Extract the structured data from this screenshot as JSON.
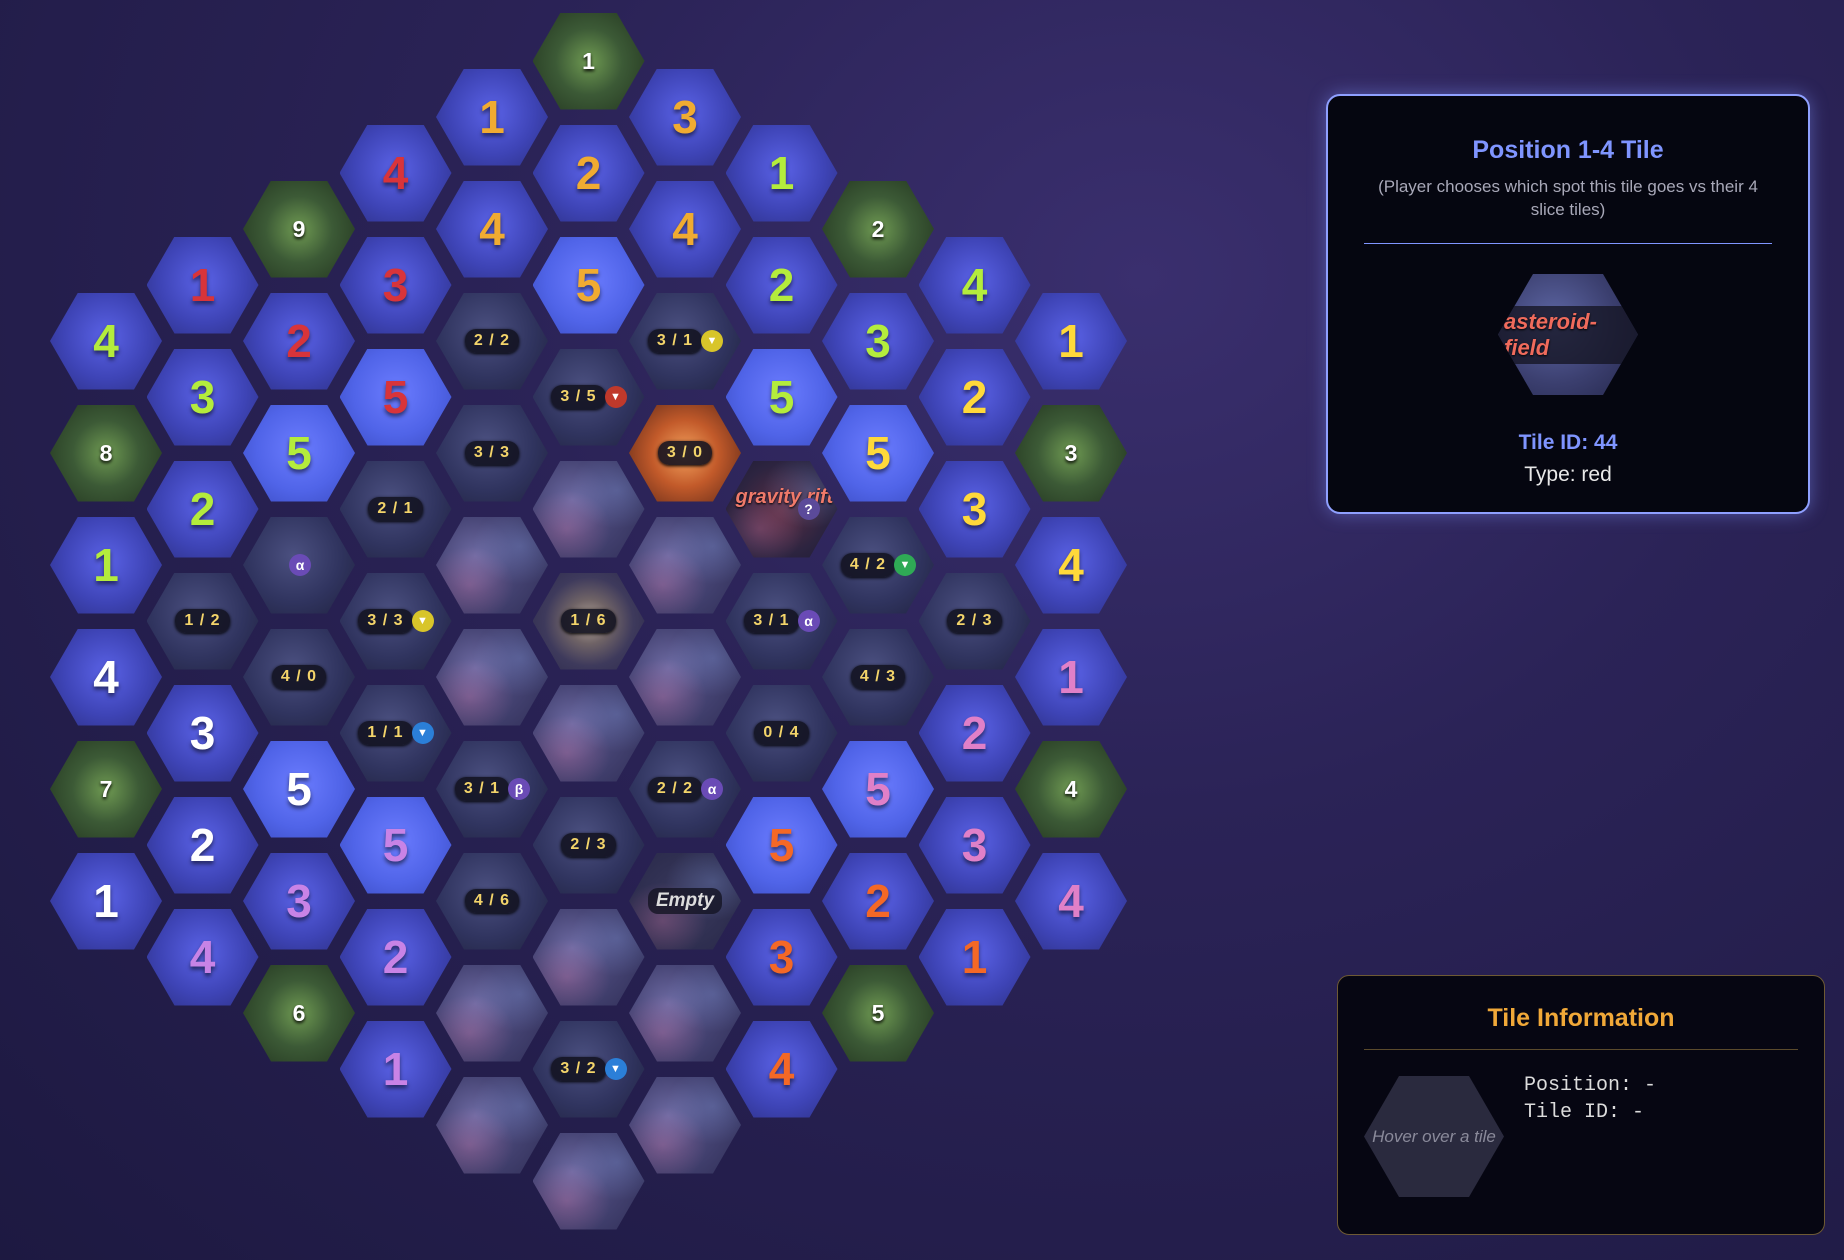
{
  "selected": {
    "title": "Position 1-4 Tile",
    "subtitle": "(Player chooses which spot this tile goes vs their 4 slice tiles)",
    "preview_label": "asteroid-field",
    "tile_id_text": "Tile ID: 44",
    "type_text": "Type: red"
  },
  "info": {
    "title": "Tile Information",
    "hover_text": "Hover over a tile",
    "position_text": "Position: -",
    "tile_id_text": "Tile ID: -"
  },
  "colors": {
    "lime": "#b4ec3c",
    "orange": "#f0ab31",
    "red": "#d8343a",
    "white": "#ffffff",
    "yellow": "#ffd93a",
    "pink": "#e080c8",
    "deep_orange": "#f46826",
    "violet": "#c883e6"
  },
  "tiles": [
    {
      "row": 0,
      "col": 5,
      "kind": "home",
      "label": "1"
    },
    {
      "row": 1,
      "col": 4,
      "kind": "num",
      "label": "1",
      "color": "#f0ab31"
    },
    {
      "row": 1,
      "col": 6,
      "kind": "num",
      "label": "3",
      "color": "#f0ab31"
    },
    {
      "row": 2,
      "col": 3,
      "kind": "num",
      "label": "4",
      "color": "#d8343a"
    },
    {
      "row": 2,
      "col": 5,
      "kind": "num",
      "label": "2",
      "color": "#f0ab31"
    },
    {
      "row": 2,
      "col": 7,
      "kind": "num",
      "label": "1",
      "color": "#b4ec3c"
    },
    {
      "row": 3,
      "col": 2,
      "kind": "home",
      "label": "9"
    },
    {
      "row": 3,
      "col": 4,
      "kind": "num",
      "label": "4",
      "color": "#f0ab31"
    },
    {
      "row": 3,
      "col": 6,
      "kind": "num",
      "label": "4",
      "color": "#f0ab31"
    },
    {
      "row": 3,
      "col": 8,
      "kind": "home",
      "label": "2"
    },
    {
      "row": 4,
      "col": 1,
      "kind": "num",
      "label": "1",
      "color": "#d8343a"
    },
    {
      "row": 4,
      "col": 3,
      "kind": "num",
      "label": "3",
      "color": "#d8343a"
    },
    {
      "row": 4,
      "col": 5,
      "kind": "num",
      "label": "5",
      "color": "#f0ab31",
      "bright": true
    },
    {
      "row": 4,
      "col": 7,
      "kind": "num",
      "label": "2",
      "color": "#b4ec3c"
    },
    {
      "row": 4,
      "col": 9,
      "kind": "num",
      "label": "4",
      "color": "#b4ec3c"
    },
    {
      "row": 5,
      "col": 0,
      "kind": "num",
      "label": "4",
      "color": "#b4ec3c"
    },
    {
      "row": 5,
      "col": 2,
      "kind": "num",
      "label": "2",
      "color": "#d8343a"
    },
    {
      "row": 5,
      "col": 4,
      "kind": "planet",
      "label": "2 / 2"
    },
    {
      "row": 5,
      "col": 6,
      "kind": "planet",
      "label": "3 / 1",
      "badge": "yellow"
    },
    {
      "row": 5,
      "col": 8,
      "kind": "num",
      "label": "3",
      "color": "#b4ec3c"
    },
    {
      "row": 5,
      "col": 10,
      "kind": "num",
      "label": "1",
      "color": "#ffd93a"
    },
    {
      "row": 6,
      "col": 1,
      "kind": "num",
      "label": "3",
      "color": "#b4ec3c"
    },
    {
      "row": 6,
      "col": 3,
      "kind": "num",
      "label": "5",
      "color": "#d8343a",
      "bright": true
    },
    {
      "row": 6,
      "col": 5,
      "kind": "planet",
      "label": "3 / 5",
      "badge": "red"
    },
    {
      "row": 6,
      "col": 7,
      "kind": "num",
      "label": "5",
      "color": "#b4ec3c",
      "bright": true
    },
    {
      "row": 6,
      "col": 9,
      "kind": "num",
      "label": "2",
      "color": "#ffd93a"
    },
    {
      "row": 7,
      "col": 0,
      "kind": "home",
      "label": "8"
    },
    {
      "row": 7,
      "col": 2,
      "kind": "num",
      "label": "5",
      "color": "#b4ec3c",
      "bright": true
    },
    {
      "row": 7,
      "col": 4,
      "kind": "planet",
      "label": "3 / 3"
    },
    {
      "row": 7,
      "col": 6,
      "kind": "supernova",
      "label": "3 / 0"
    },
    {
      "row": 7,
      "col": 8,
      "kind": "num",
      "label": "5",
      "color": "#ffd93a",
      "bright": true
    },
    {
      "row": 7,
      "col": 10,
      "kind": "home",
      "label": "3"
    },
    {
      "row": 8,
      "col": 1,
      "kind": "num",
      "label": "2",
      "color": "#b4ec3c"
    },
    {
      "row": 8,
      "col": 3,
      "kind": "planet",
      "label": "2 / 1"
    },
    {
      "row": 8,
      "col": 5,
      "kind": "nebula"
    },
    {
      "row": 8,
      "col": 7,
      "kind": "rift",
      "label": "gravity rift",
      "badge": "?"
    },
    {
      "row": 8,
      "col": 9,
      "kind": "num",
      "label": "3",
      "color": "#ffd93a"
    },
    {
      "row": 9,
      "col": 0,
      "kind": "num",
      "label": "1",
      "color": "#b4ec3c"
    },
    {
      "row": 9,
      "col": 2,
      "kind": "planet",
      "badge": "α"
    },
    {
      "row": 9,
      "col": 4,
      "kind": "nebula"
    },
    {
      "row": 9,
      "col": 6,
      "kind": "nebula"
    },
    {
      "row": 9,
      "col": 8,
      "kind": "planet",
      "label": "4 / 2",
      "badge": "green"
    },
    {
      "row": 9,
      "col": 10,
      "kind": "num",
      "label": "4",
      "color": "#ffd93a"
    },
    {
      "row": 10,
      "col": 1,
      "kind": "planet",
      "label": "1 / 2"
    },
    {
      "row": 10,
      "col": 3,
      "kind": "planet",
      "label": "3 / 3",
      "badge": "yellow"
    },
    {
      "row": 10,
      "col": 5,
      "kind": "center",
      "label": "1 / 6"
    },
    {
      "row": 10,
      "col": 7,
      "kind": "planet",
      "label": "3 / 1",
      "badge": "α"
    },
    {
      "row": 10,
      "col": 9,
      "kind": "planet",
      "label": "2 / 3"
    },
    {
      "row": 11,
      "col": 0,
      "kind": "num",
      "label": "4",
      "color": "#ffffff"
    },
    {
      "row": 11,
      "col": 2,
      "kind": "planet",
      "label": "4 / 0"
    },
    {
      "row": 11,
      "col": 4,
      "kind": "nebula"
    },
    {
      "row": 11,
      "col": 6,
      "kind": "nebula"
    },
    {
      "row": 11,
      "col": 8,
      "kind": "planet",
      "label": "4 / 3"
    },
    {
      "row": 11,
      "col": 10,
      "kind": "num",
      "label": "1",
      "color": "#e080c8"
    },
    {
      "row": 12,
      "col": 1,
      "kind": "num",
      "label": "3",
      "color": "#ffffff"
    },
    {
      "row": 12,
      "col": 3,
      "kind": "planet",
      "label": "1 / 1",
      "badge": "blue"
    },
    {
      "row": 12,
      "col": 5,
      "kind": "nebula"
    },
    {
      "row": 12,
      "col": 7,
      "kind": "planet",
      "label": "0 / 4"
    },
    {
      "row": 12,
      "col": 9,
      "kind": "num",
      "label": "2",
      "color": "#e080c8"
    },
    {
      "row": 13,
      "col": 0,
      "kind": "home",
      "label": "7"
    },
    {
      "row": 13,
      "col": 2,
      "kind": "num",
      "label": "5",
      "color": "#ffffff",
      "bright": true
    },
    {
      "row": 13,
      "col": 4,
      "kind": "planet",
      "label": "3 / 1",
      "badge": "β"
    },
    {
      "row": 13,
      "col": 6,
      "kind": "planet",
      "label": "2 / 2",
      "badge": "α"
    },
    {
      "row": 13,
      "col": 8,
      "kind": "num",
      "label": "5",
      "color": "#e080c8",
      "bright": true
    },
    {
      "row": 13,
      "col": 10,
      "kind": "home",
      "label": "4"
    },
    {
      "row": 14,
      "col": 1,
      "kind": "num",
      "label": "2",
      "color": "#ffffff"
    },
    {
      "row": 14,
      "col": 3,
      "kind": "num",
      "label": "5",
      "color": "#c883e6",
      "bright": true
    },
    {
      "row": 14,
      "col": 5,
      "kind": "planet",
      "label": "2 / 3"
    },
    {
      "row": 14,
      "col": 7,
      "kind": "num",
      "label": "5",
      "color": "#f46826",
      "bright": true
    },
    {
      "row": 14,
      "col": 9,
      "kind": "num",
      "label": "3",
      "color": "#e080c8"
    },
    {
      "row": 15,
      "col": 0,
      "kind": "num",
      "label": "1",
      "color": "#ffffff"
    },
    {
      "row": 15,
      "col": 2,
      "kind": "num",
      "label": "3",
      "color": "#c883e6"
    },
    {
      "row": 15,
      "col": 4,
      "kind": "planet",
      "label": "4 / 6"
    },
    {
      "row": 15,
      "col": 6,
      "kind": "empty",
      "label": "Empty"
    },
    {
      "row": 15,
      "col": 8,
      "kind": "num",
      "label": "2",
      "color": "#f46826"
    },
    {
      "row": 15,
      "col": 10,
      "kind": "num",
      "label": "4",
      "color": "#e080c8"
    },
    {
      "row": 16,
      "col": 1,
      "kind": "num",
      "label": "4",
      "color": "#c883e6"
    },
    {
      "row": 16,
      "col": 3,
      "kind": "num",
      "label": "2",
      "color": "#c883e6"
    },
    {
      "row": 16,
      "col": 5,
      "kind": "nebula"
    },
    {
      "row": 16,
      "col": 7,
      "kind": "num",
      "label": "3",
      "color": "#f46826"
    },
    {
      "row": 16,
      "col": 9,
      "kind": "num",
      "label": "1",
      "color": "#f46826"
    },
    {
      "row": 17,
      "col": 2,
      "kind": "home",
      "label": "6"
    },
    {
      "row": 17,
      "col": 4,
      "kind": "nebula"
    },
    {
      "row": 17,
      "col": 6,
      "kind": "nebula"
    },
    {
      "row": 17,
      "col": 8,
      "kind": "home",
      "label": "5"
    },
    {
      "row": 18,
      "col": 3,
      "kind": "num",
      "label": "1",
      "color": "#c883e6"
    },
    {
      "row": 18,
      "col": 5,
      "kind": "planet",
      "label": "3 / 2",
      "badge": "blue"
    },
    {
      "row": 18,
      "col": 7,
      "kind": "num",
      "label": "4",
      "color": "#f46826"
    },
    {
      "row": 19,
      "col": 4,
      "kind": "nebula"
    },
    {
      "row": 19,
      "col": 6,
      "kind": "nebula"
    },
    {
      "row": 20,
      "col": 5,
      "kind": "nebula"
    }
  ]
}
